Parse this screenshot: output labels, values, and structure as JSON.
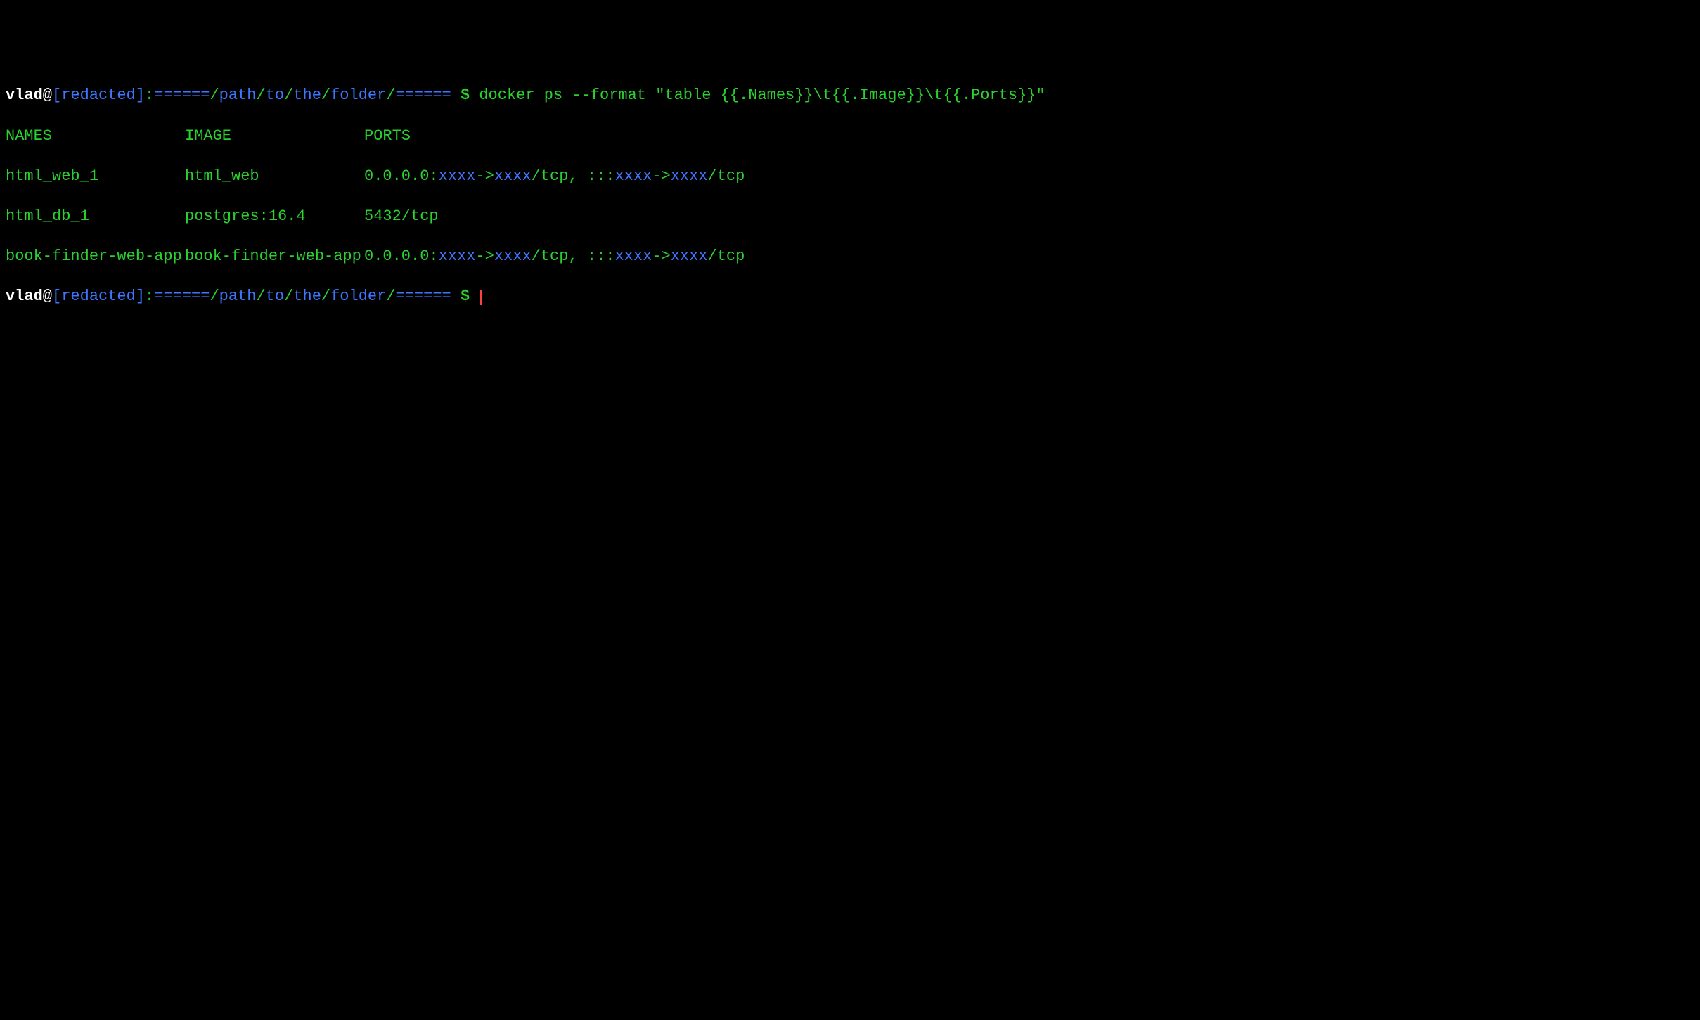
{
  "prompt1": {
    "user": "vlad@",
    "host_open": "[",
    "host": "redacted",
    "host_close": "]",
    "colon": ":",
    "path_sep1": "======",
    "path_parts": [
      "path",
      "to",
      "the",
      "folder"
    ],
    "path_sep2": "======",
    "dollar": "$",
    "command": "docker ps --format \"table {{.Names}}\\t{{.Image}}\\t{{.Ports}}\""
  },
  "table": {
    "headers": {
      "names": "NAMES",
      "image": "IMAGE",
      "ports": "PORTS"
    },
    "rows": [
      {
        "name": "html_web_1",
        "image": "html_web",
        "ports_prefix": "0.0.0.0:",
        "ports_part1": "xxxx",
        "ports_arrow": "->",
        "ports_part2": "xxxx",
        "ports_tcp": "/tcp, :::",
        "ports_part3": "xxxx",
        "ports_arrow2": "->",
        "ports_part4": "xxxx",
        "ports_tcp2": "/tcp"
      },
      {
        "name": "html_db_1",
        "image": "postgres:16.4",
        "ports_simple": "5432/tcp"
      },
      {
        "name": "book-finder-web-app",
        "image": "book-finder-web-app",
        "ports_prefix": "0.0.0.0:",
        "ports_part1": "xxxx",
        "ports_arrow": "->",
        "ports_part2": "xxxx",
        "ports_tcp": "/tcp, :::",
        "ports_part3": "xxxx",
        "ports_arrow2": "->",
        "ports_part4": "xxxx",
        "ports_tcp2": "/tcp"
      }
    ]
  },
  "prompt2": {
    "user": "vlad@",
    "host_open": "[",
    "host": "redacted",
    "host_close": "]",
    "colon": ":",
    "path_sep1": "======",
    "path_parts": [
      "path",
      "to",
      "the",
      "folder"
    ],
    "path_sep2": "======",
    "dollar": "$"
  }
}
